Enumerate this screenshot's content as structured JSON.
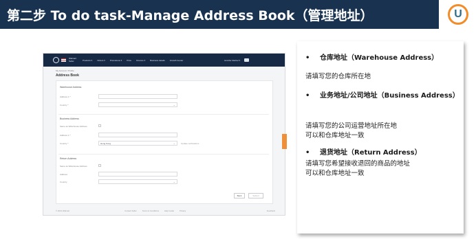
{
  "slide": {
    "title": "第二步 To do task-Manage Address Book（管理地址）",
    "logo_letter": "U"
  },
  "app": {
    "brand": "Walmart Seller",
    "nav": [
      "Products ▾",
      "Orders ▾",
      "Promotions ▾",
      "Price",
      "Finance ▾",
      "Business details",
      "Growth Center"
    ],
    "user": "Jennifer Rachel ▾",
    "breadcrumb": "My Account  /  Profile",
    "page_title": "Address Book",
    "sections": [
      {
        "title": "Warehouse Address",
        "fields": [
          {
            "label": "Address 1 *",
            "kind": "text",
            "value": ""
          },
          {
            "label": "Country *",
            "kind": "select",
            "value": ""
          }
        ]
      },
      {
        "title": "Business Address",
        "checkbox_label": "Same as Warehouse Address",
        "fields": [
          {
            "label": "Address 1 *",
            "kind": "text",
            "value": ""
          },
          {
            "label": "Country *",
            "kind": "select",
            "value": "Hong Kong"
          }
        ],
        "hint": "Update verifications"
      },
      {
        "title": "Return Address",
        "checkbox_label": "Same as Warehouse Address",
        "fields": [
          {
            "label": "Address",
            "kind": "text",
            "value": ""
          },
          {
            "label": "Country",
            "kind": "select",
            "value": ""
          }
        ]
      }
    ],
    "buttons": {
      "back": "Back",
      "submit": "Submit"
    },
    "footer": {
      "copyright": "© 2021 Walmart",
      "links": [
        "Contact Seller",
        "Terms & Conditions",
        "Help Guide",
        "Privacy"
      ],
      "right": "Feedback"
    }
  },
  "notes": [
    {
      "heading": "仓库地址（Warehouse Address）",
      "desc": [
        "请填写您的仓库所在地"
      ]
    },
    {
      "heading": "业务地址/公司地址（Business Address）",
      "desc": [
        "请填写您的公司运营地址所在地",
        "可以和仓库地址一致"
      ]
    },
    {
      "heading": "退货地址（Return Address）",
      "desc": [
        "请填写您希望接收退回的商品的地址",
        "可以和仓库地址一致"
      ]
    }
  ],
  "colors": {
    "title_bar": "#18324f",
    "logo_ring": "#f28c28",
    "nav_bar": "#162a45",
    "accent_tab": "#ee8f3a"
  }
}
